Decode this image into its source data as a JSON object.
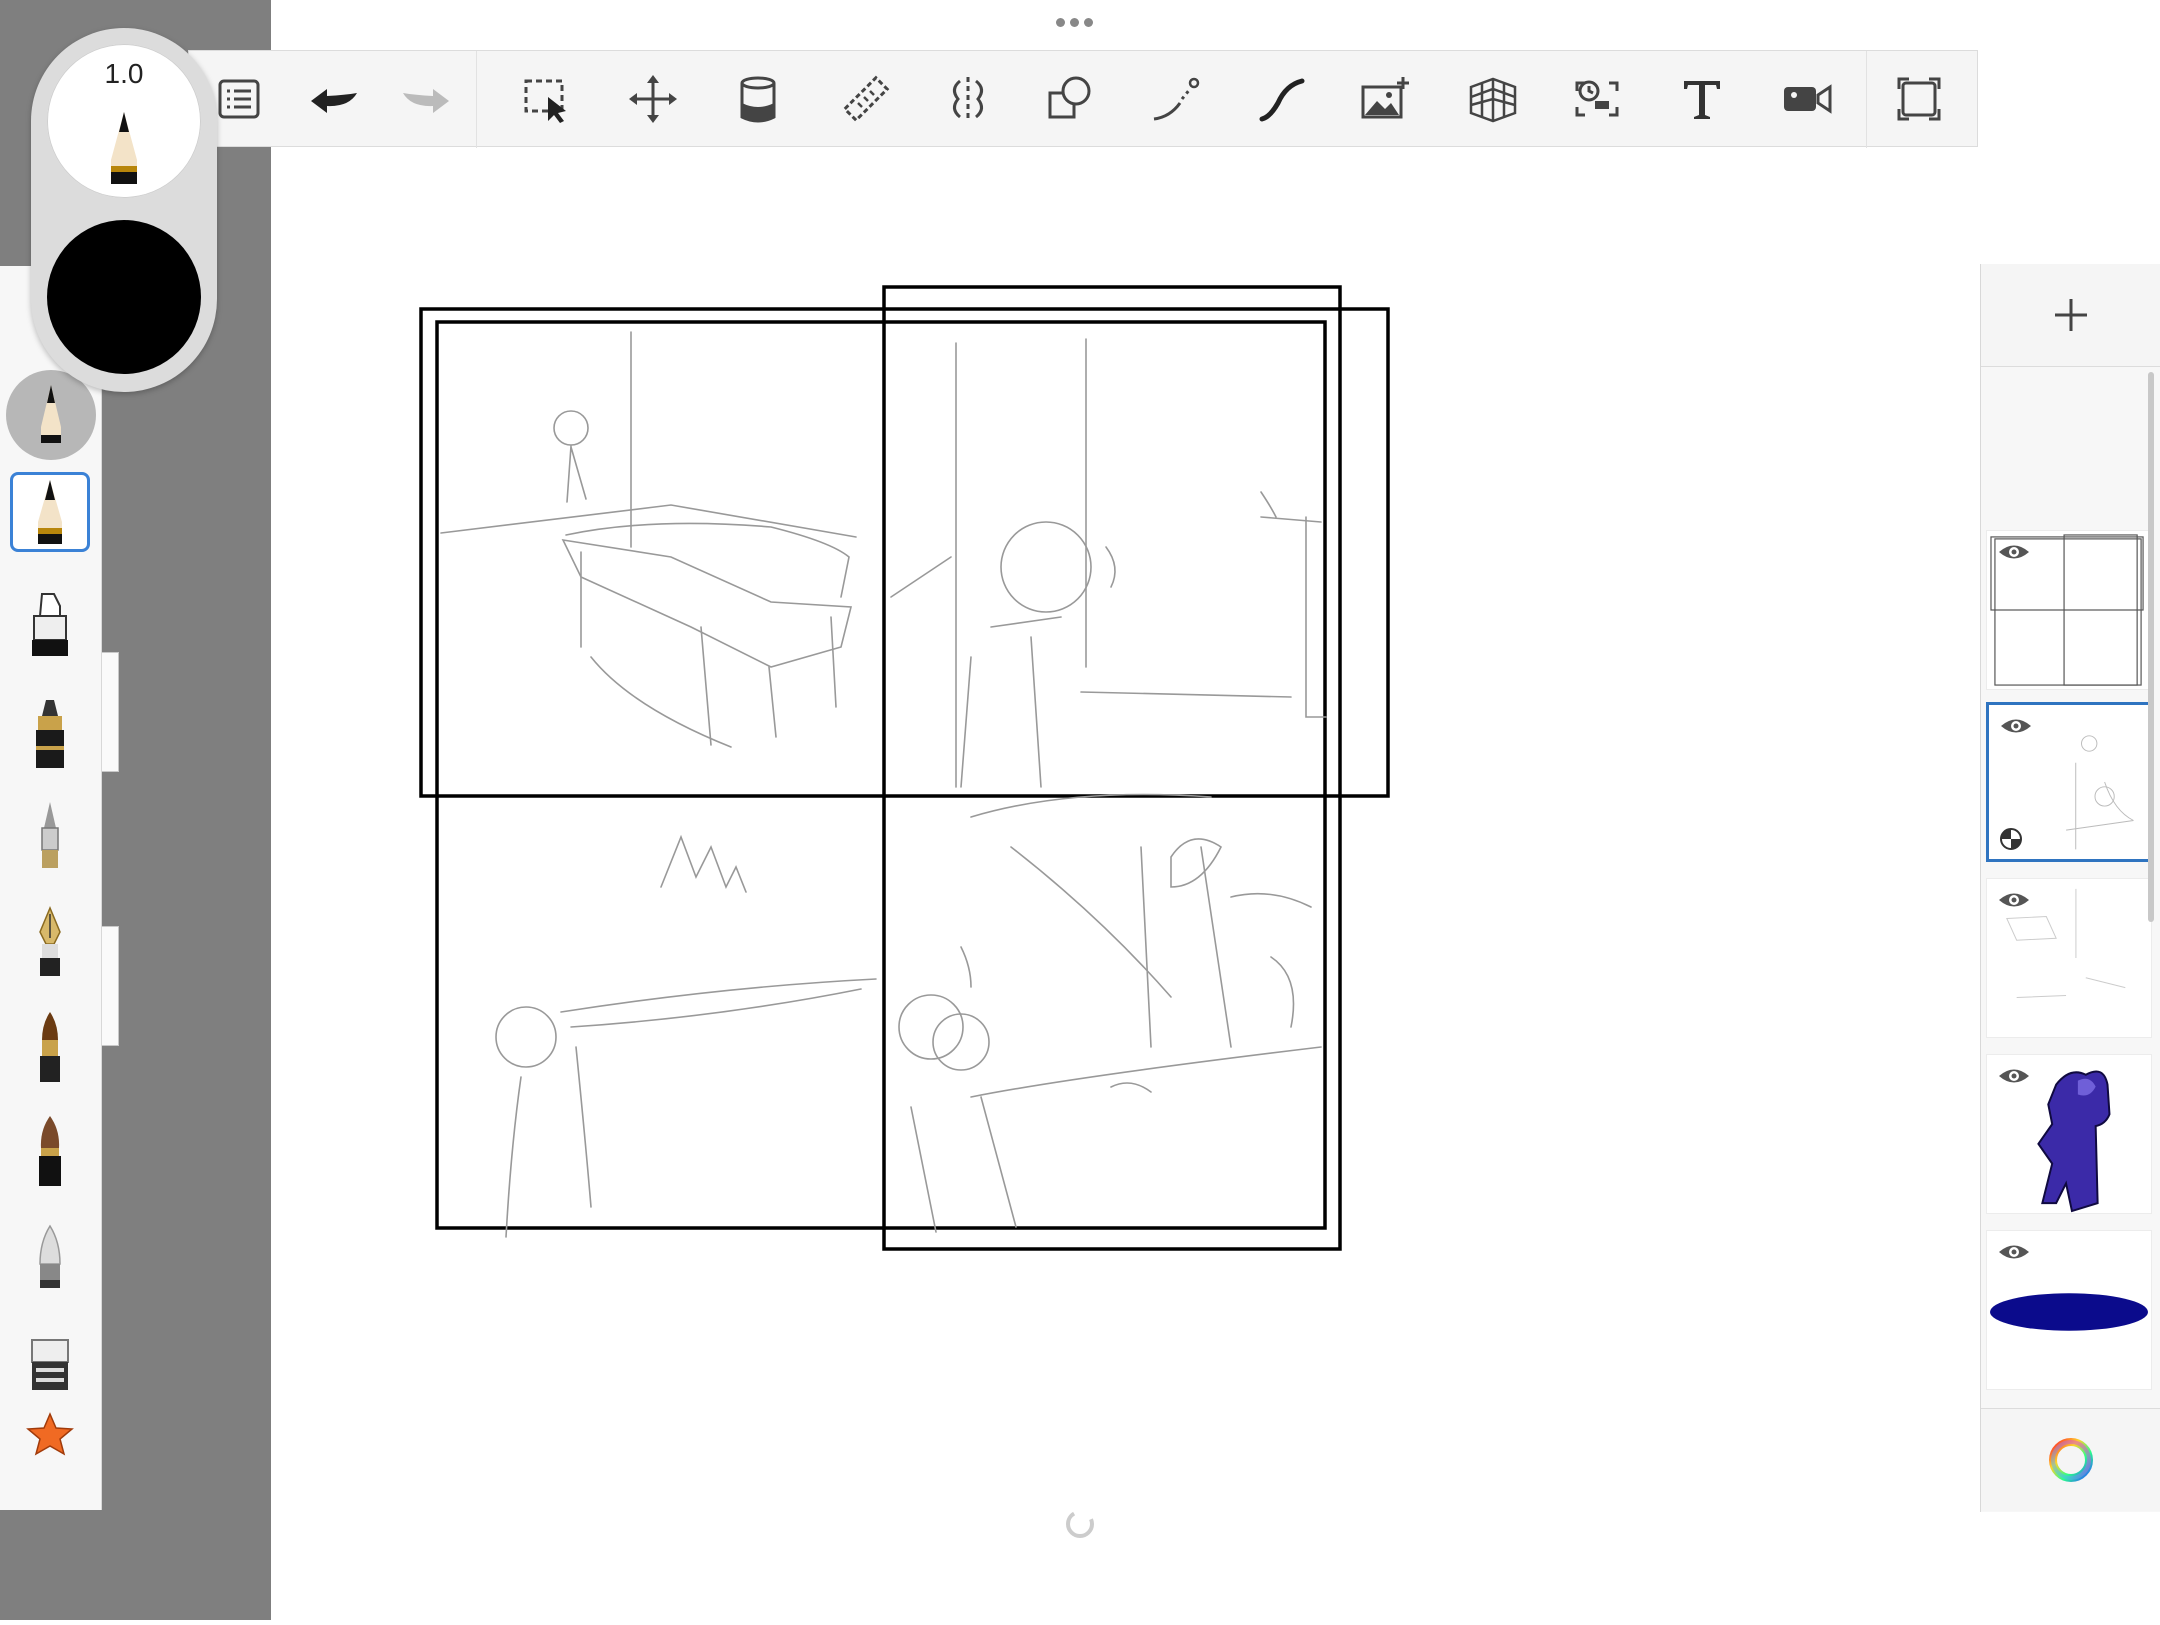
{
  "app": {
    "toolbar": {
      "tools": [
        "layers-list",
        "undo",
        "redo",
        "selection",
        "transform",
        "fill",
        "ruler",
        "symmetry",
        "shape",
        "stroke",
        "curve",
        "import-image",
        "perspective-guide",
        "time-lapse",
        "text",
        "record",
        "fullscreen"
      ]
    },
    "brush_puck": {
      "size": "1.0",
      "color": "#000000"
    },
    "brushes": [
      "pencil",
      "pencil",
      "marker",
      "ink-pen",
      "technical-pen",
      "fountain-pen",
      "paintbrush",
      "watercolor-brush",
      "airbrush",
      "eraser",
      "favorite-star"
    ],
    "selected_brush_index": 1,
    "layers": [
      {
        "name": "panel-borders",
        "visible": true
      },
      {
        "name": "sketch-layer",
        "visible": true,
        "selected": true
      },
      {
        "name": "sketch-layer-2",
        "visible": true
      },
      {
        "name": "character",
        "visible": true
      },
      {
        "name": "blue-shape",
        "visible": true
      }
    ],
    "colors": {
      "accent": "#2f74c0",
      "layer_blue": "#0b0b8c",
      "character_purple": "#3b2aa8"
    }
  }
}
